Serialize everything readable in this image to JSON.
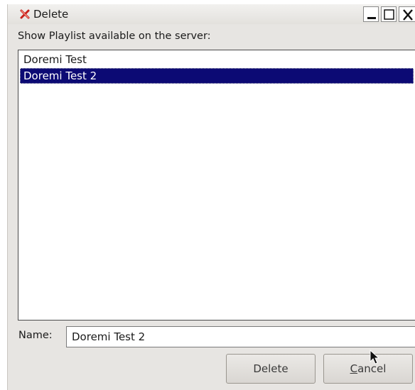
{
  "window": {
    "title": "Delete",
    "icon": "red-x-icon",
    "controls": [
      "minimize-icon",
      "maximize-icon",
      "close-icon"
    ]
  },
  "prompt": "Show Playlist available on the server:",
  "playlists": {
    "items": [
      "Doremi Test",
      "Doremi Test 2"
    ],
    "selected": "Doremi Test 2"
  },
  "name_field": {
    "label": "Name:",
    "value": "Doremi Test 2"
  },
  "buttons": {
    "delete": "Delete",
    "cancel_mnemonic": "C",
    "cancel_rest": "ancel"
  },
  "colors": {
    "selection": "#0c0a74",
    "dialog_bg": "#e7e5e2"
  }
}
